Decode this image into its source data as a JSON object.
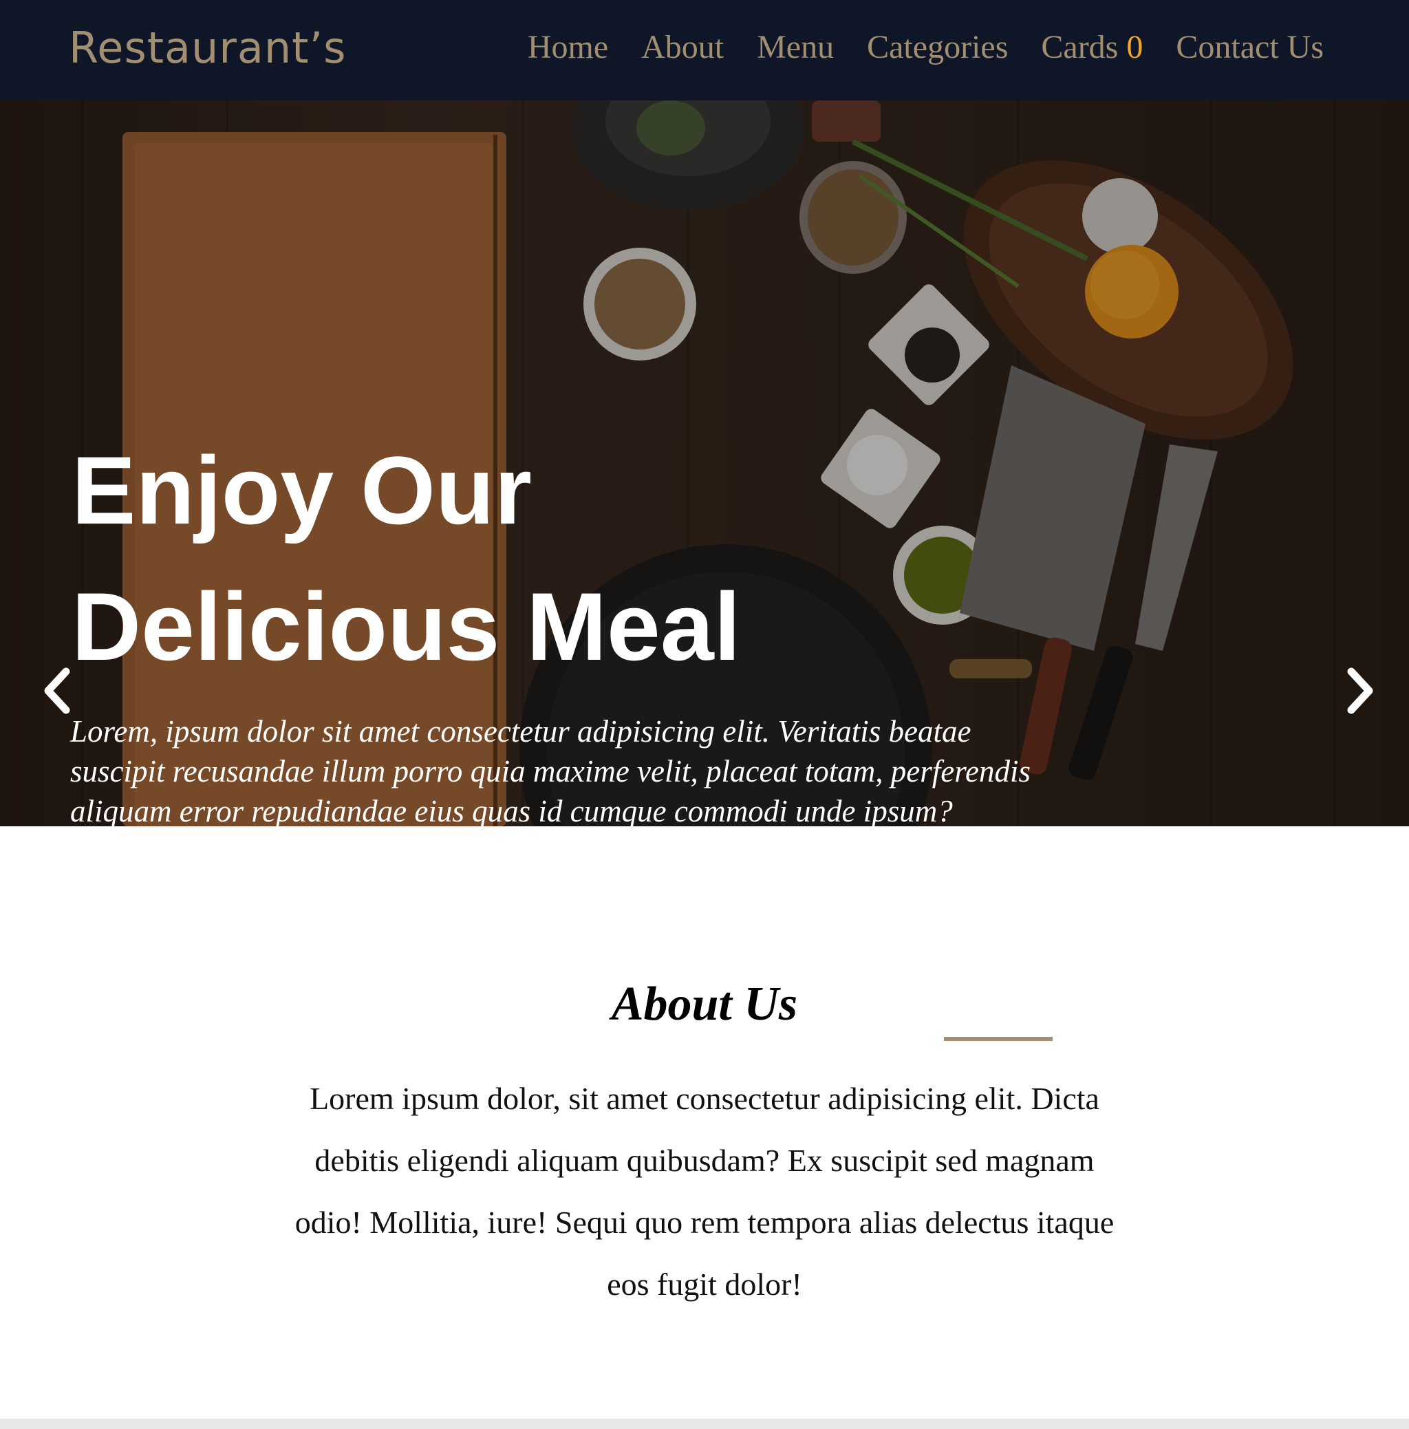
{
  "navbar": {
    "brand": "Restaurant’s",
    "links": {
      "home": "Home",
      "about": "About",
      "menu": "Menu",
      "categories": "Categories",
      "cards": "Cards",
      "cards_count": "0",
      "contact": "Contact Us"
    }
  },
  "hero": {
    "title": "Enjoy Our Delicious Meal",
    "text": "Lorem, ipsum dolor sit amet consectetur adipisicing elit. Veritatis beatae suscipit recusandae illum porro quia maxime velit, placeat totam, perferendis aliquam error repudiandae eius quas id cumque commodi unde ipsum?",
    "prev_icon": "chevron-left-icon",
    "next_icon": "chevron-right-icon"
  },
  "about": {
    "title": "About Us",
    "text": "Lorem ipsum dolor, sit amet consectetur adipisicing elit. Dicta debitis eligendi aliquam quibusdam? Ex suscipit sed magnam odio! Mollitia, iure! Sequi quo rem tempora alias delectus itaque eos fugit dolor!"
  },
  "colors": {
    "navbar_bg": "#0e1628",
    "accent": "#a28f72",
    "cart_count": "#f5a623",
    "hero_text": "#ffffff"
  }
}
